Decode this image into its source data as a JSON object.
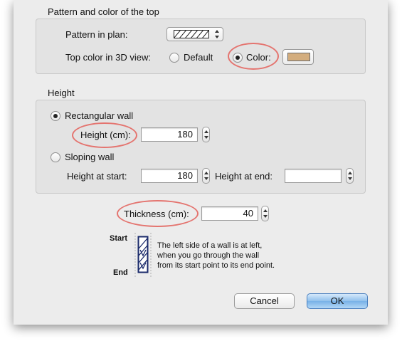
{
  "top_section": {
    "title": "Pattern and color of the top",
    "pattern_label": "Pattern in plan:",
    "top_color_label": "Top color in 3D view:",
    "default_option": "Default",
    "color_option": "Color:",
    "selected": "color",
    "top_color": "#d3ad7e"
  },
  "height_section": {
    "title": "Height",
    "rectangular_label": "Rectangular wall",
    "height_label": "Height (cm):",
    "height_value": "180",
    "sloping_label": "Sloping wall",
    "height_start_label": "Height at start:",
    "height_start_value": "180",
    "height_end_label": "Height at end:",
    "height_end_value": "",
    "selected": "rectangular"
  },
  "thickness": {
    "label": "Thickness (cm):",
    "value": "40"
  },
  "diagram": {
    "start_label": "Start",
    "end_label": "End",
    "note_lines": [
      "The left side of a wall is at left,",
      "when you go through the wall",
      "from its start point to its end point."
    ]
  },
  "buttons": {
    "cancel": "Cancel",
    "ok": "OK"
  },
  "colors": {
    "highlight_ellipse": "#e4746f",
    "default_button": "#78b2e7"
  }
}
